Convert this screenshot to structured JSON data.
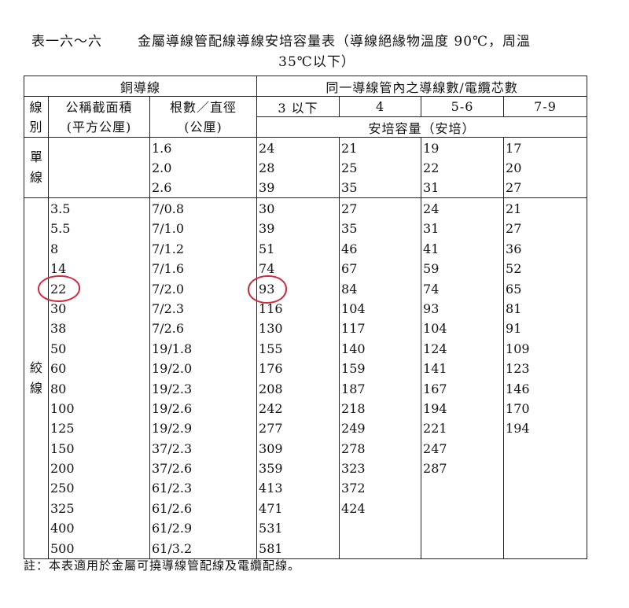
{
  "title": {
    "label": "表一六～六",
    "line1": "金屬導線管配線導線安培容量表（導線絕緣物溫度 90℃，周溫",
    "line2": "35℃以下）"
  },
  "header": {
    "copper": "銅導線",
    "conductor_count": "同一導線管內之導線數/電纜芯數",
    "type_col": "線\n別",
    "area_col": "公稱截面積\n(平方公厘)",
    "strands_col": "根數／直徑\n(公厘)",
    "counts": [
      "3 以下",
      "4",
      "5-6",
      "7-9"
    ],
    "ampacity": "安培容量（安培）"
  },
  "groups": {
    "single": "單\n線",
    "stranded": "絞\n線"
  },
  "single": {
    "area": [],
    "strands": [
      "1.6",
      "2.0",
      "2.6"
    ],
    "c3": [
      "24",
      "28",
      "39"
    ],
    "c4": [
      "21",
      "25",
      "35"
    ],
    "c56": [
      "19",
      "22",
      "31"
    ],
    "c79": [
      "17",
      "20",
      "27"
    ]
  },
  "stranded": {
    "area": [
      "3.5",
      "5.5",
      "8",
      "14",
      "22",
      "30",
      "38",
      "50",
      "60",
      "80",
      "100",
      "125",
      "150",
      "200",
      "250",
      "325",
      "400",
      "500"
    ],
    "strands": [
      "7/0.8",
      "7/1.0",
      "7/1.2",
      "7/1.6",
      "7/2.0",
      "7/2.3",
      "7/2.6",
      "19/1.8",
      "19/2.0",
      "19/2.3",
      "19/2.6",
      "19/2.9",
      "37/2.3",
      "37/2.6",
      "61/2.3",
      "61/2.6",
      "61/2.9",
      "61/3.2"
    ],
    "c3": [
      "30",
      "39",
      "51",
      "74",
      "93",
      "116",
      "130",
      "155",
      "176",
      "208",
      "242",
      "277",
      "309",
      "359",
      "413",
      "471",
      "531",
      "581"
    ],
    "c4": [
      "27",
      "35",
      "46",
      "67",
      "84",
      "104",
      "117",
      "140",
      "159",
      "187",
      "218",
      "249",
      "278",
      "323",
      "372",
      "424"
    ],
    "c56": [
      "24",
      "31",
      "41",
      "59",
      "74",
      "93",
      "104",
      "124",
      "141",
      "167",
      "194",
      "221",
      "247",
      "287"
    ],
    "c79": [
      "21",
      "27",
      "36",
      "52",
      "65",
      "81",
      "91",
      "109",
      "123",
      "146",
      "170",
      "194"
    ]
  },
  "note": "註：本表適用於金屬可撓導線管配線及電纜配線。",
  "annotations": {
    "circle_color": "#d2283c",
    "circled_values": [
      "22",
      "93"
    ]
  }
}
